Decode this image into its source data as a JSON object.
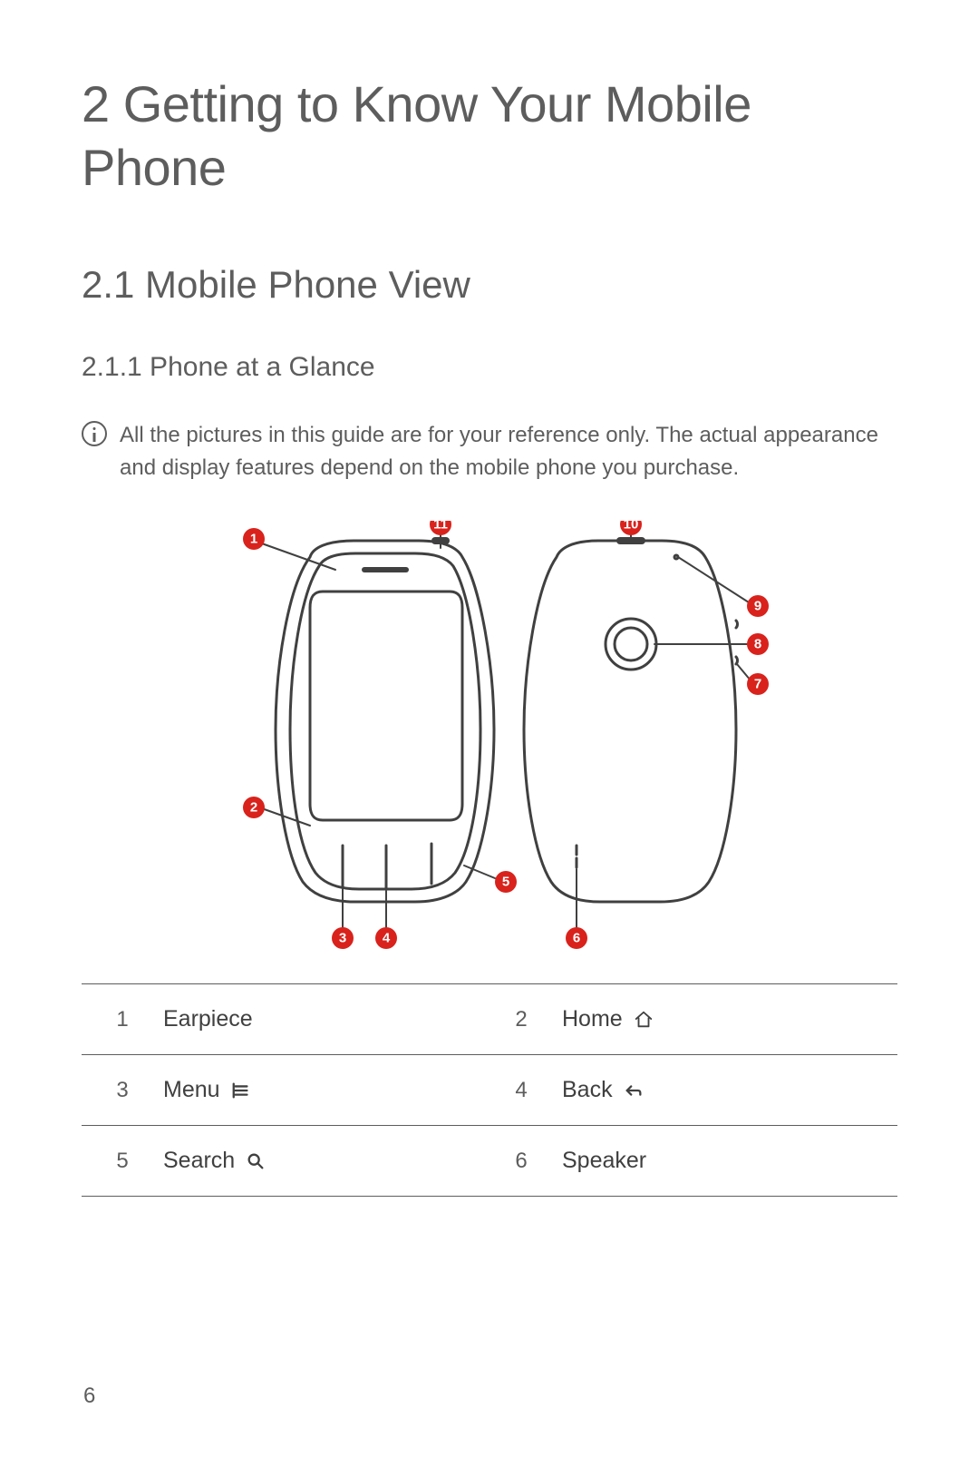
{
  "headings": {
    "chapter": "2  Getting to Know Your Mobile Phone",
    "section": "2.1  Mobile Phone View",
    "subsection": "2.1.1  Phone at a Glance"
  },
  "note": "All the pictures in this guide are for your reference only. The actual appearance and display features depend on the mobile phone you purchase.",
  "callouts": [
    "1",
    "2",
    "3",
    "4",
    "5",
    "6",
    "7",
    "8",
    "9",
    "10",
    "11"
  ],
  "legend": [
    {
      "num": "1",
      "label": "Earpiece",
      "icon": null
    },
    {
      "num": "2",
      "label": "Home",
      "icon": "home"
    },
    {
      "num": "3",
      "label": "Menu",
      "icon": "menu"
    },
    {
      "num": "4",
      "label": "Back",
      "icon": "back"
    },
    {
      "num": "5",
      "label": "Search",
      "icon": "search"
    },
    {
      "num": "6",
      "label": "Speaker",
      "icon": null
    }
  ],
  "page_number": "6"
}
